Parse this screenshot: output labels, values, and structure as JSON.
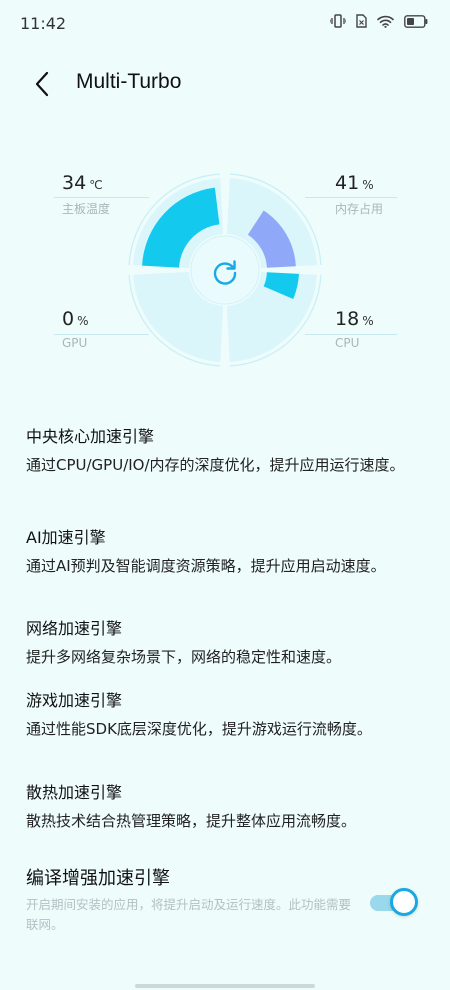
{
  "status_bar": {
    "time": "11:42",
    "icons": [
      "vibrate-icon",
      "sim-icon",
      "wifi-icon",
      "battery-icon"
    ]
  },
  "header": {
    "title": "Multi-Turbo",
    "back_icon": "chevron-left-icon"
  },
  "dashboard": {
    "board_temp": {
      "value": "34",
      "unit": "℃",
      "label": "主板温度"
    },
    "memory": {
      "value": "41",
      "unit": "%",
      "label": "内存占用"
    },
    "gpu": {
      "value": "0",
      "unit": "%",
      "label": "GPU"
    },
    "cpu": {
      "value": "18",
      "unit": "%",
      "label": "CPU"
    },
    "refresh_icon": "refresh-icon",
    "colors": {
      "temp": "#13c9ee",
      "memory": "#8fa9f8",
      "cpu": "#13c9ee",
      "track": "#daf6fb"
    }
  },
  "features": [
    {
      "title": "中央核心加速引擎",
      "desc": "通过CPU/GPU/IO/内存的深度优化，提升应用运行速度。"
    },
    {
      "title": "AI加速引擎",
      "desc": "通过AI预判及智能调度资源策略，提升应用启动速度。"
    },
    {
      "title": "网络加速引擎",
      "desc": "提升多网络复杂场景下，网络的稳定性和速度。"
    },
    {
      "title": "游戏加速引擎",
      "desc": "通过性能SDK底层深度优化，提升游戏运行流畅度。"
    },
    {
      "title": "散热加速引擎",
      "desc": "散热技术结合热管理策略，提升整体应用流畅度。"
    }
  ],
  "compile_boost": {
    "title": "编译增强加速引擎",
    "desc": "开启期间安装的应用，将提升启动及运行速度。此功能需要联网。",
    "enabled": true,
    "accent": "#1aa8e0"
  }
}
